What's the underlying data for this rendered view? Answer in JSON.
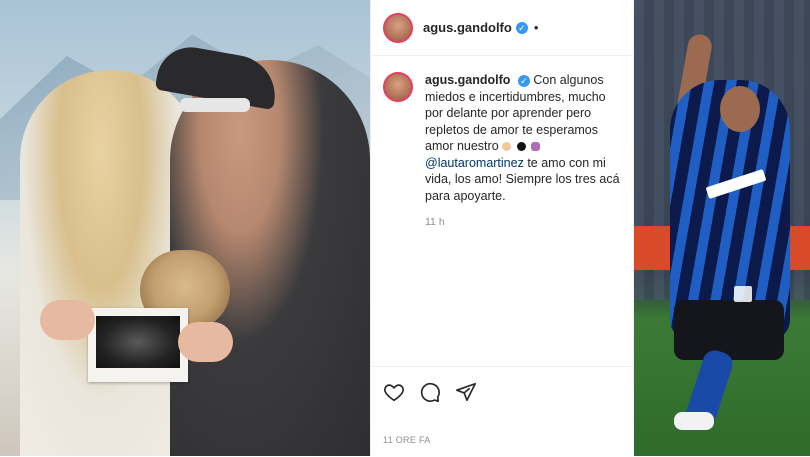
{
  "post": {
    "username": "agus.gandolfo",
    "verified_badge": "verified-icon",
    "follow_dot": "•",
    "caption": {
      "username": "agus.gandolfo",
      "text_part1": "Con algunos miedos e incertidumbres, mucho por delante por aprender pero repletos de amor te esperamos amor nuestro",
      "mention": "@lautaromartinez",
      "text_part2": "te amo con mi vida, los amo! Siempre los tres acá para apoyarte.",
      "emojis": [
        "baby-face-emoji",
        "black-heart-emoji",
        "baby-bottle-emoji"
      ]
    },
    "relative_time": "11 h",
    "footer_time": "11 ORE FA",
    "actions": [
      "heart-icon",
      "comment-icon",
      "share-icon"
    ]
  },
  "colors": {
    "text": "#262626",
    "muted": "#8e8e8e",
    "mention": "#00376b",
    "verified": "#3897f0",
    "story_ring": "#e4405f"
  }
}
